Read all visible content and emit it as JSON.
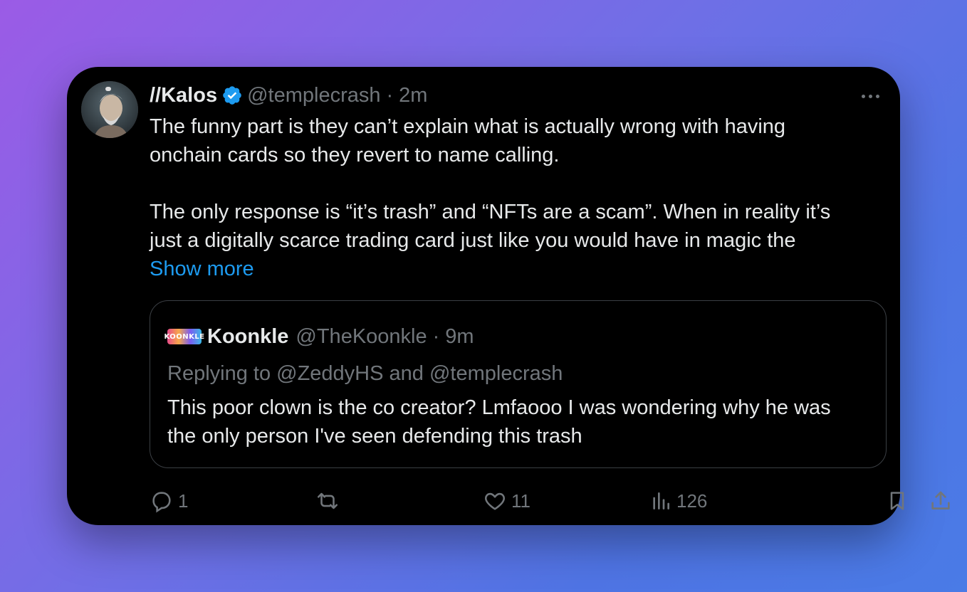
{
  "tweet": {
    "author_name": "//Kalos",
    "author_handle": "@templecrash",
    "separator": "·",
    "time": "2m",
    "paragraphs": [
      [
        "The funny part is they can’t explain what is actually wrong with having",
        "onchain cards so they revert to name calling."
      ],
      [
        "The only response is “it’s trash” and “NFTs are a scam”. When in reality it’s",
        "just a digitally scarce trading card just like you would have in magic the"
      ]
    ],
    "show_more": "Show more"
  },
  "quoted": {
    "avatar_text": "KOONKLE",
    "author_name": "Koonkle",
    "author_handle": "@TheKoonkle",
    "separator": "·",
    "time": "9m",
    "replying": "Replying to @ZeddyHS and @templecrash",
    "lines": [
      "This poor clown is the co creator? Lmfaooo I was wondering why he was",
      "the only person I've seen defending this trash"
    ]
  },
  "actions": {
    "replies": "1",
    "retweets": "",
    "likes": "11",
    "views": "126"
  },
  "colors": {
    "accent": "#1d9bf0",
    "muted": "#71767b",
    "text": "#e7e9ea",
    "background": "#000000"
  },
  "icons": [
    "verified-badge-icon",
    "more-icon",
    "reply-icon",
    "retweet-icon",
    "like-icon",
    "views-icon",
    "bookmark-icon",
    "share-icon"
  ]
}
